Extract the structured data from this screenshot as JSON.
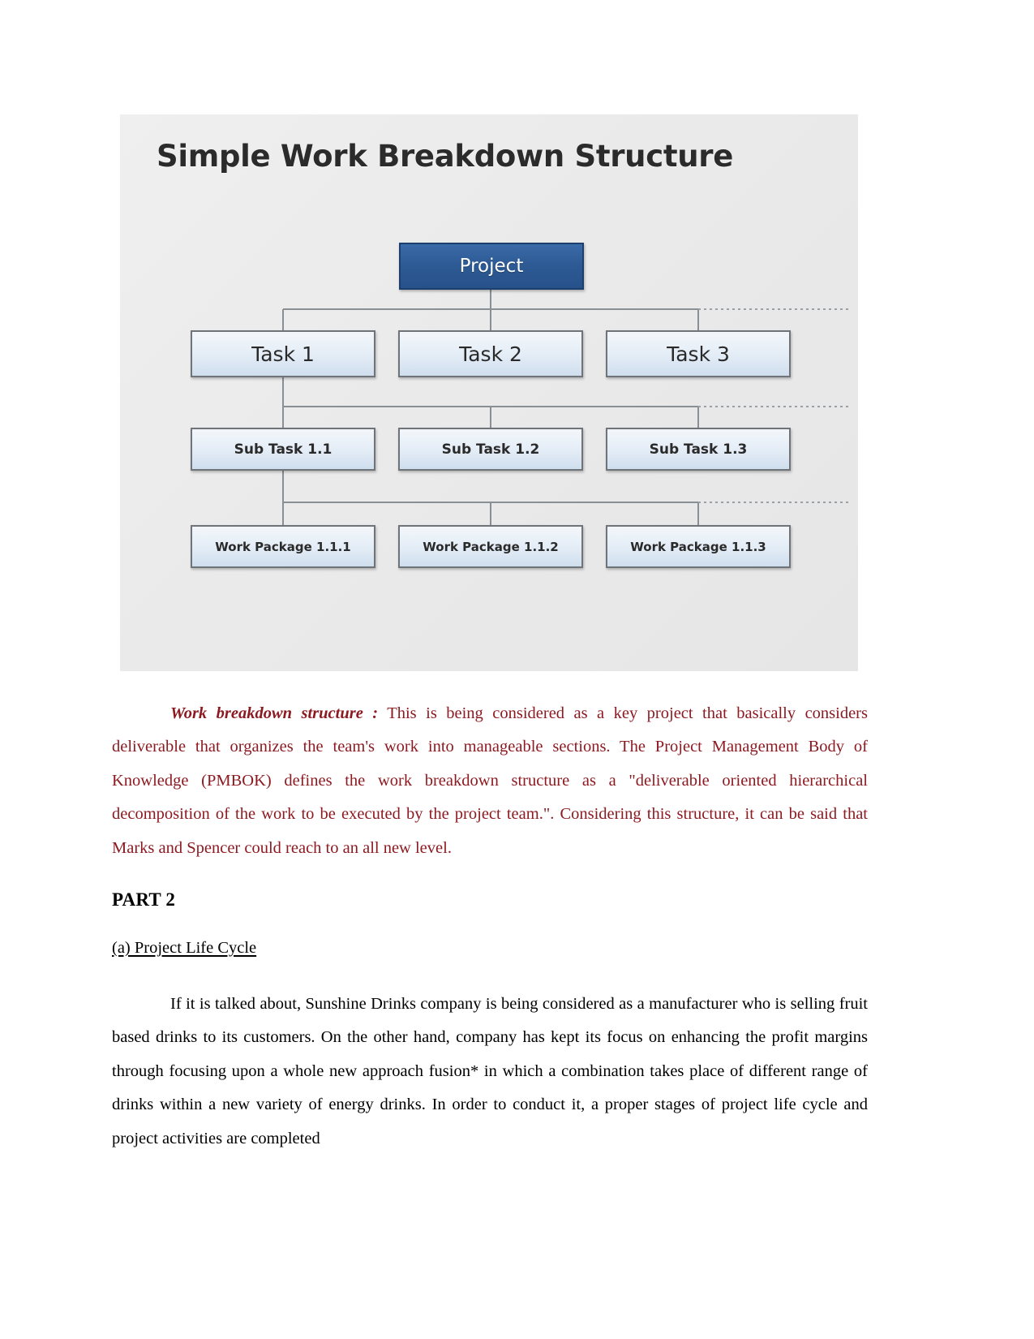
{
  "figure": {
    "title": "Simple Work Breakdown Structure",
    "diagram": {
      "type": "hierarchy",
      "root": "Project",
      "levels": [
        {
          "name": "tasks",
          "nodes": [
            "Task 1",
            "Task 2",
            "Task 3"
          ]
        },
        {
          "name": "subtasks",
          "nodes": [
            "Sub Task 1.1",
            "Sub Task 1.2",
            "Sub Task 1.3"
          ]
        },
        {
          "name": "work_packages",
          "nodes": [
            "Work Package 1.1.1",
            "Work Package 1.1.2",
            "Work Package 1.1.3"
          ]
        }
      ],
      "colors": {
        "root_fill": "#2e5b95",
        "root_border": "#1d3f6e",
        "node_fill": "#e3ecf6",
        "node_border": "#6f7479",
        "background": "#ececec"
      }
    }
  },
  "body": {
    "red_paragraph": {
      "lead": "Work breakdown structure :",
      "text": " This is being considered as a key project that basically considers deliverable that organizes the team's work into manageable sections. The Project Management Body of Knowledge (PMBOK) defines the work breakdown structure as a \"deliverable oriented hierarchical decomposition of the work to be executed by the project team.\". Considering this structure, it can be said that Marks and Spencer could reach to an all new level."
    },
    "part_heading": "PART 2",
    "section_heading": "(a) Project Life Cycle",
    "black_paragraph": "If it is talked about, Sunshine Drinks company is being considered as a manufacturer who is selling fruit based drinks to its customers. On the other hand, company has kept its focus on enhancing the profit margins through focusing upon a whole new approach fusion* in which a combination takes place of different range of drinks within a new variety of energy drinks. In order to conduct it, a proper  stages of project life cycle and project activities are completed",
    "text_colors": {
      "red": "#8c1a21",
      "black": "#000000"
    }
  }
}
